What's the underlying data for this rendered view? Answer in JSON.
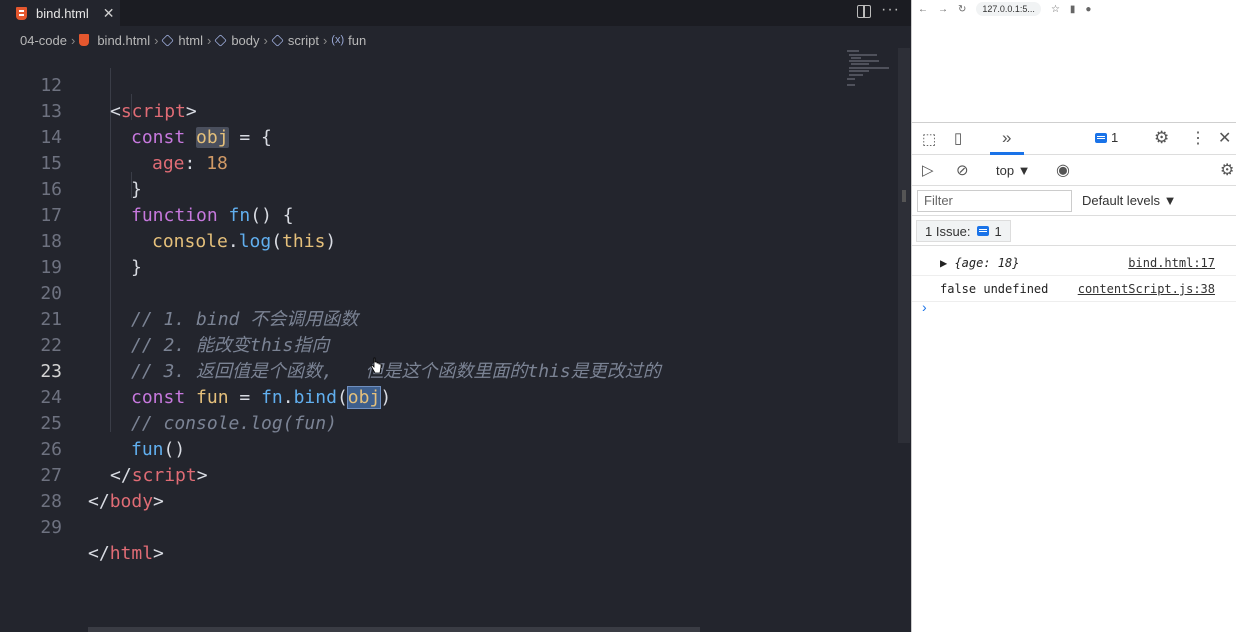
{
  "editor": {
    "tab_label": "bind.html",
    "tab_close": "✕",
    "more": "···",
    "breadcrumb": [
      "04-code",
      "bind.html",
      "html",
      "body",
      "script",
      "fun"
    ]
  },
  "code_lines": [
    {
      "n": "12"
    },
    {
      "n": "13"
    },
    {
      "n": "14"
    },
    {
      "n": "15"
    },
    {
      "n": "16"
    },
    {
      "n": "17"
    },
    {
      "n": "18"
    },
    {
      "n": "19"
    },
    {
      "n": "20"
    },
    {
      "n": "21"
    },
    {
      "n": "22"
    },
    {
      "n": "23"
    },
    {
      "n": "24"
    },
    {
      "n": "25"
    },
    {
      "n": "26"
    },
    {
      "n": "27"
    },
    {
      "n": "28"
    },
    {
      "n": "29"
    }
  ],
  "code": {
    "l12_open": "<",
    "l12_tag": "script",
    "l12_close": ">",
    "l13_kw": "const",
    "l13_var": "obj",
    "l13_rest": " = {",
    "l14_prop": "age",
    "l14_colon": ": ",
    "l14_num": "18",
    "l15": "}",
    "l16_kw": "function",
    "l16_fn": "fn",
    "l16_rest": "() {",
    "l17_obj": "console",
    "l17_dot": ".",
    "l17_fn": "log",
    "l17_open": "(",
    "l17_this": "this",
    "l17_close": ")",
    "l18": "}",
    "l20": "// 1. bind 不会调用函数",
    "l21": "// 2. 能改变this指向",
    "l22": "// 3. 返回值是个函数,   但是这个函数里面的this是更改过的",
    "l23_kw": "const",
    "l23_var": "fun",
    "l23_eq": " = ",
    "l23_fn": "fn",
    "l23_dot": ".",
    "l23_bind": "bind",
    "l23_open": "(",
    "l23_arg": "obj",
    "l23_close": ")",
    "l24": "// console.log(fun)",
    "l25_fn": "fun",
    "l25_rest": "()",
    "l26_open": "</",
    "l26_tag": "script",
    "l26_close": ">",
    "l27_open": "</",
    "l27_tag": "body",
    "l27_close": ">",
    "l29_open": "</",
    "l29_tag": "html",
    "l29_close": ">"
  },
  "browser": {
    "url": "127.0.0.1:5...",
    "devtools": {
      "more_tabs": "»",
      "issues_count": "1",
      "context": "top ▼",
      "filter_placeholder": "Filter",
      "levels": "Default levels ▼",
      "issues_label": "1 Issue:",
      "issues_badge": "1",
      "console": [
        {
          "text": "▶ {age: 18}",
          "source": "bind.html:17"
        },
        {
          "text": "false undefined",
          "source": "contentScript.js:38"
        }
      ],
      "prompt": "›"
    }
  },
  "colors": {
    "editor_bg": "#23252d",
    "keyword": "#c678dd",
    "function": "#61afef",
    "tag": "#e06c75",
    "number": "#d19a66",
    "comment": "#7b8394"
  }
}
